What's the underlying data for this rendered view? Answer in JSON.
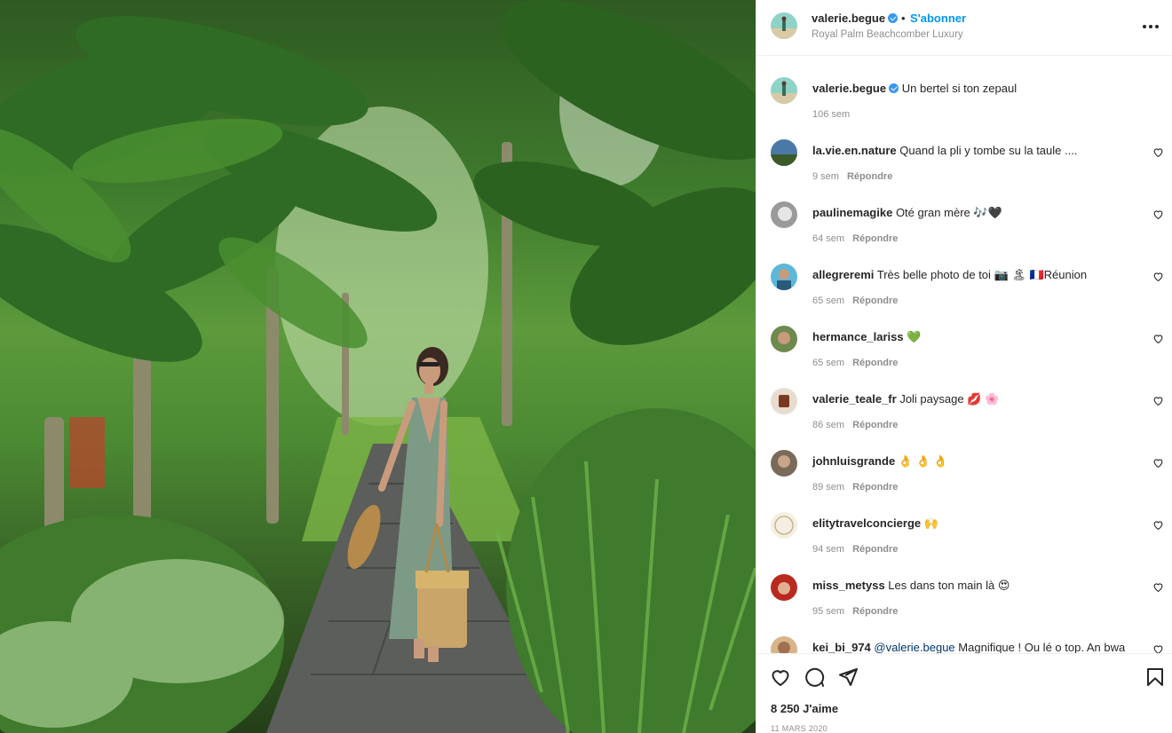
{
  "post": {
    "author": "valerie.begue",
    "follow_label": "S'abonner",
    "dot": "•",
    "location": "Royal Palm Beachcomber Luxury",
    "more_label": "•••"
  },
  "caption": {
    "username": "valerie.begue",
    "text": "Un bertel si ton zepaul",
    "time": "106 sem"
  },
  "reply_label": "Répondre",
  "comments": [
    {
      "username": "la.vie.en.nature",
      "text": "Quand la pli y tombe su la taule ....",
      "time": "9 sem"
    },
    {
      "username": "paulinemagike",
      "text": "Oté gran mère 🎶🖤",
      "time": "64 sem"
    },
    {
      "username": "allegreremi",
      "text": "Très belle photo de toi 📷 🏝 🇫🇷Réunion",
      "time": "65 sem"
    },
    {
      "username": "hermance_lariss",
      "text": "💚",
      "time": "65 sem"
    },
    {
      "username": "valerie_teale_fr",
      "text": "Joli paysage 💋 🌸",
      "time": "86 sem"
    },
    {
      "username": "johnluisgrande",
      "text": "👌 👌 👌",
      "time": "89 sem"
    },
    {
      "username": "elitytravelconcierge",
      "text": "🙌",
      "time": "94 sem"
    },
    {
      "username": "miss_metyss",
      "text": "Les dans ton main là 😍",
      "time": "95 sem"
    },
    {
      "username": "kei_bi_974",
      "mention": "@valerie.begue",
      "text": "Magnifique ! Ou lé o top. An bwa",
      "time": ""
    }
  ],
  "actions": {
    "like_icon": "heart-icon",
    "comment_icon": "comment-icon",
    "share_icon": "share-icon",
    "save_icon": "bookmark-icon"
  },
  "likes": "8 250 J'aime",
  "date": "11 MARS 2020"
}
